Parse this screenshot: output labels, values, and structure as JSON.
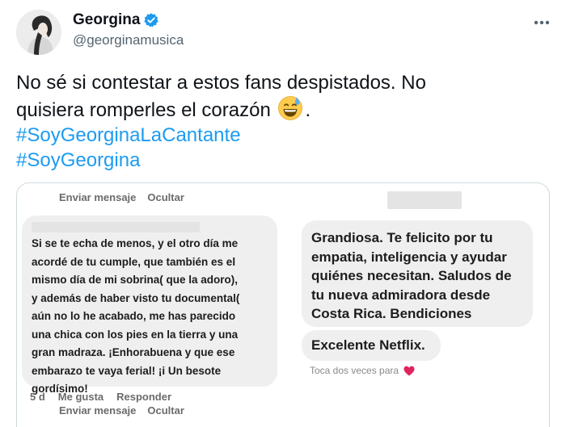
{
  "tweet": {
    "author": {
      "display_name": "Georgina",
      "handle": "@georginamusica",
      "verified_icon": "verified-badge-icon",
      "avatar_icon": "avatar"
    },
    "more_icon": "more-options-icon",
    "text_lines": [
      "No sé si contestar a estos fans despistados.  No",
      "quisiera romperles el corazón"
    ],
    "text_end": ".",
    "emoji": "grinning-face-with-sweat-emoji",
    "hashtags": [
      "#SoyGeorginaLaCantante",
      "#SoyGeorgina"
    ],
    "colors": {
      "hashtag": "#1d9bf0",
      "text": "#0f1419",
      "secondary": "#536471",
      "verified": "#1d9bf0"
    }
  },
  "media": {
    "top_actions": {
      "send_message": "Enviar mensaje",
      "hide": "Ocultar"
    },
    "left_comment": {
      "lines": [
        "Si se te echa de menos, y el otro día me",
        "acordé de tu cumple, que también es el",
        "mismo día de mi sobrina( que la adoro),",
        "y además de haber visto tu documental(",
        "aún no lo he acabado, me has parecido",
        "una chica con los pies en la tierra y una",
        "gran madraza. ¡Enhorabuena y que ese",
        "embarazo te vaya ferial! ¡i Un besote",
        "gordísimo!"
      ],
      "age": "5 d",
      "like": "Me gusta",
      "reply": "Responder",
      "send_message": "Enviar mensaje",
      "hide": "Ocultar"
    },
    "right_messages": {
      "message1_lines": [
        "Grandiosa. Te felicito por tu",
        "empatia, inteligencia y ayudar",
        "quiénes necesitan. Saludos de",
        "tu nueva admiradora desde",
        "Costa Rica. Bendiciones"
      ],
      "message2": "Excelente Netflix.",
      "double_tap": "Toca dos veces para",
      "heart_icon": "heart-icon",
      "heart_color": "#e0245e"
    }
  }
}
